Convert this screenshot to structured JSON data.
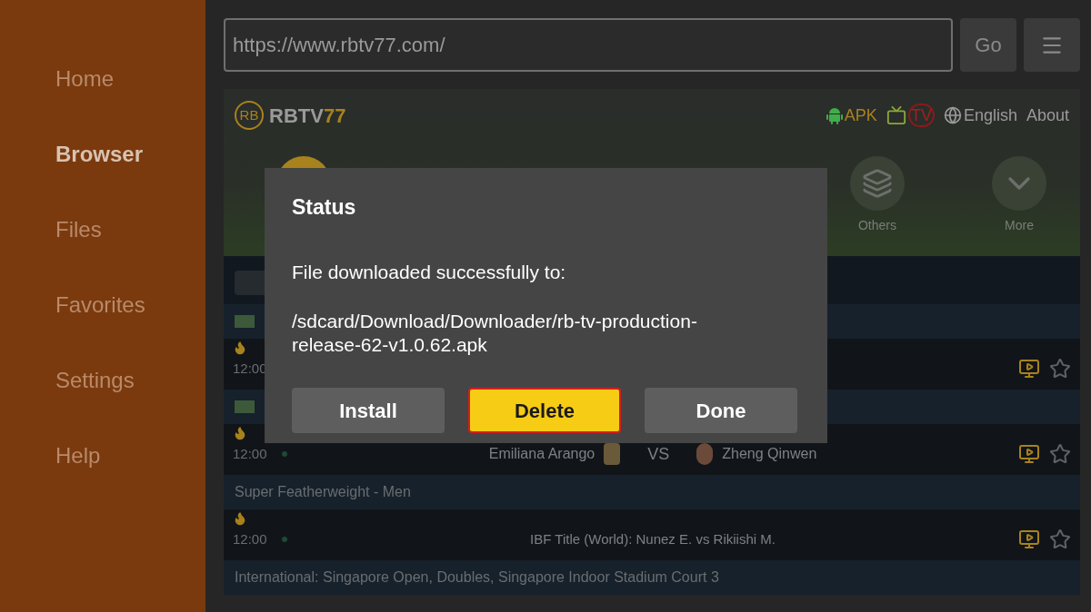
{
  "sidebar": {
    "items": [
      {
        "label": "Home",
        "selected": false
      },
      {
        "label": "Browser",
        "selected": true
      },
      {
        "label": "Files",
        "selected": false
      },
      {
        "label": "Favorites",
        "selected": false
      },
      {
        "label": "Settings",
        "selected": false
      },
      {
        "label": "Help",
        "selected": false
      }
    ]
  },
  "address_bar": {
    "value": "https://www.rbtv77.com/",
    "go_button": "Go"
  },
  "site": {
    "logo_badge": "RB",
    "logo_text": "RBTV",
    "logo_accent": "77",
    "nav": [
      {
        "kind": "android",
        "label": "APK",
        "selected": false
      },
      {
        "kind": "tv",
        "label": "TV",
        "selected": true
      },
      {
        "kind": "globe",
        "label": "English",
        "selected": false
      },
      {
        "kind": "plain",
        "label": "About",
        "selected": false
      }
    ],
    "categories": [
      {
        "kind": "layers",
        "label": "Others"
      },
      {
        "kind": "chevron",
        "label": "More"
      }
    ],
    "rows": [
      {
        "kind": "league"
      },
      {
        "kind": "match",
        "time": "12:00"
      },
      {
        "kind": "league"
      },
      {
        "kind": "match",
        "time": "12:00",
        "home": "Emiliana Arango",
        "vs": "VS",
        "away": "Zheng Qinwen"
      },
      {
        "kind": "header",
        "text": "Super Featherweight - Men"
      },
      {
        "kind": "match",
        "time": "12:00",
        "title": "IBF Title (World): Nunez E. vs Rikiishi M."
      },
      {
        "kind": "header",
        "text": "International: Singapore Open, Doubles, Singapore Indoor Stadium Court 3"
      }
    ]
  },
  "dialog": {
    "title": "Status",
    "message": "File downloaded successfully to:",
    "path": "/sdcard/Download/Downloader/rb-tv-production-release-62-v1.0.62.apk",
    "buttons": [
      {
        "label": "Install",
        "selected": false
      },
      {
        "label": "Delete",
        "selected": true
      },
      {
        "label": "Done",
        "selected": false
      }
    ]
  }
}
